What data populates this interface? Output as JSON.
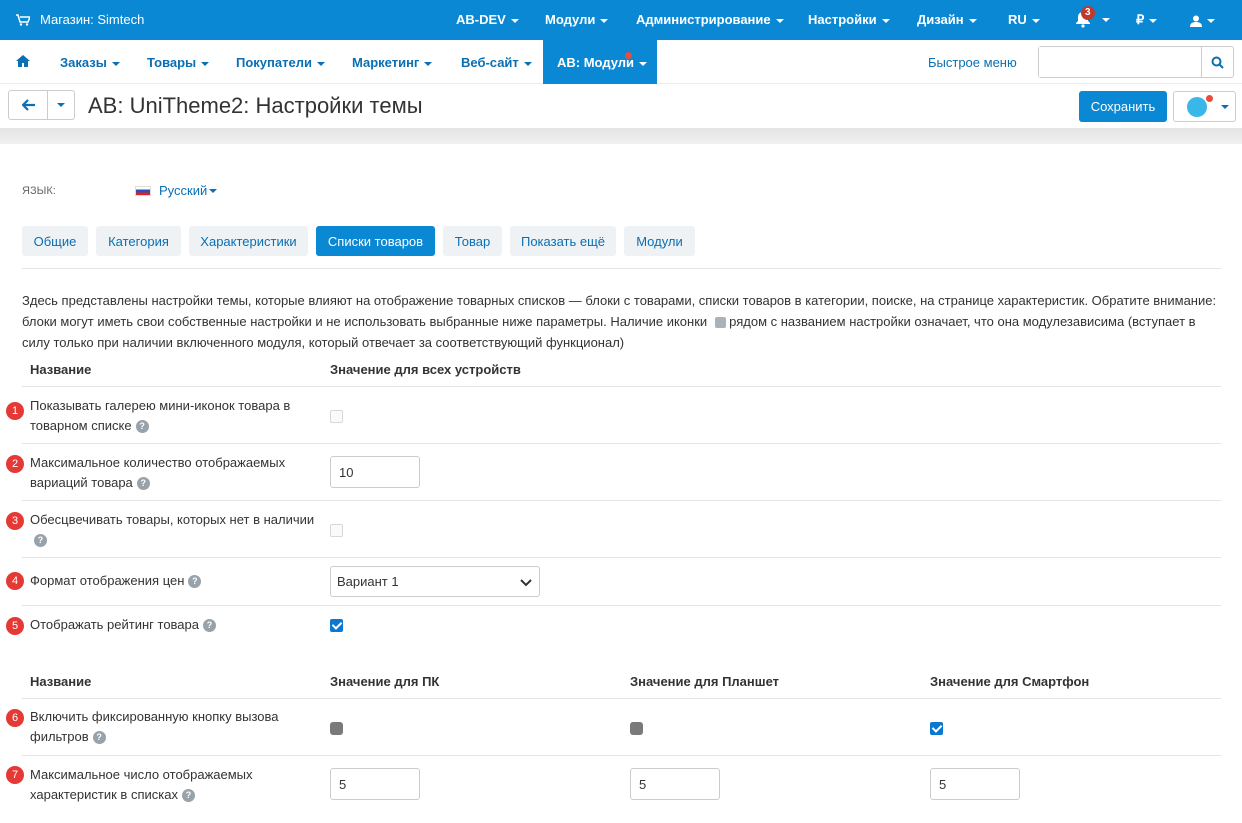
{
  "topbar": {
    "store_label": "Магазин: Simtech",
    "menus": [
      "AB-DEV",
      "Модули",
      "Администрирование",
      "Настройки",
      "Дизайн",
      "RU"
    ],
    "notifications_count": "3",
    "currency": "₽"
  },
  "nav": {
    "items": [
      "Заказы",
      "Товары",
      "Покупатели",
      "Маркетинг",
      "Веб-сайт"
    ],
    "active": "AB: Модули",
    "quick_menu": "Быстрое меню",
    "search_placeholder": ""
  },
  "title": {
    "text": "AB: UniTheme2: Настройки темы",
    "save_label": "Сохранить"
  },
  "language": {
    "label": "Язык:",
    "value": "Русский"
  },
  "tabs": [
    "Общие",
    "Категория",
    "Характеристики",
    "Списки товаров",
    "Товар",
    "Показать ещё",
    "Модули"
  ],
  "active_tab": "Списки товаров",
  "description_part1": "Здесь представлены настройки темы, которые влияют на отображение товарных списков — блоки с товарами, списки товаров в категории, поиске, на странице характеристик. Обратите внимание: блоки могут иметь свои собственные настройки и не использовать выбранные ниже параметры. Наличие иконки",
  "description_part2": "рядом с названием настройки означает, что она модулезависима (вступает в силу только при наличии включенного модуля, который отвечает за соответствующий функционал)",
  "table1": {
    "col_name": "Название",
    "col_value": "Значение для всех устройств",
    "rows": [
      {
        "num": "1",
        "label": "Показывать галерею мини-иконок товара в товарном списке",
        "type": "checkbox",
        "checked": false
      },
      {
        "num": "2",
        "label": "Максимальное количество отображаемых вариаций товара",
        "type": "text",
        "value": "10"
      },
      {
        "num": "3",
        "label": "Обесцвечивать товары, которых нет в наличии",
        "type": "checkbox",
        "checked": false
      },
      {
        "num": "4",
        "label": "Формат отображения цен",
        "type": "select",
        "value": "Вариант 1"
      },
      {
        "num": "5",
        "label": "Отображать рейтинг товара",
        "type": "checkbox",
        "checked": true
      }
    ]
  },
  "table2": {
    "col_name": "Название",
    "col_pc": "Значение для ПК",
    "col_tablet": "Значение для Планшет",
    "col_phone": "Значение для Смартфон",
    "rows": [
      {
        "num": "6",
        "label": "Включить фиксированную кнопку вызова фильтров",
        "pc": "off",
        "tablet": "off",
        "phone": "on"
      },
      {
        "num": "7",
        "label": "Максимальное число отображаемых характеристик в списках",
        "pc": "5",
        "tablet": "5",
        "phone": "5"
      }
    ]
  }
}
